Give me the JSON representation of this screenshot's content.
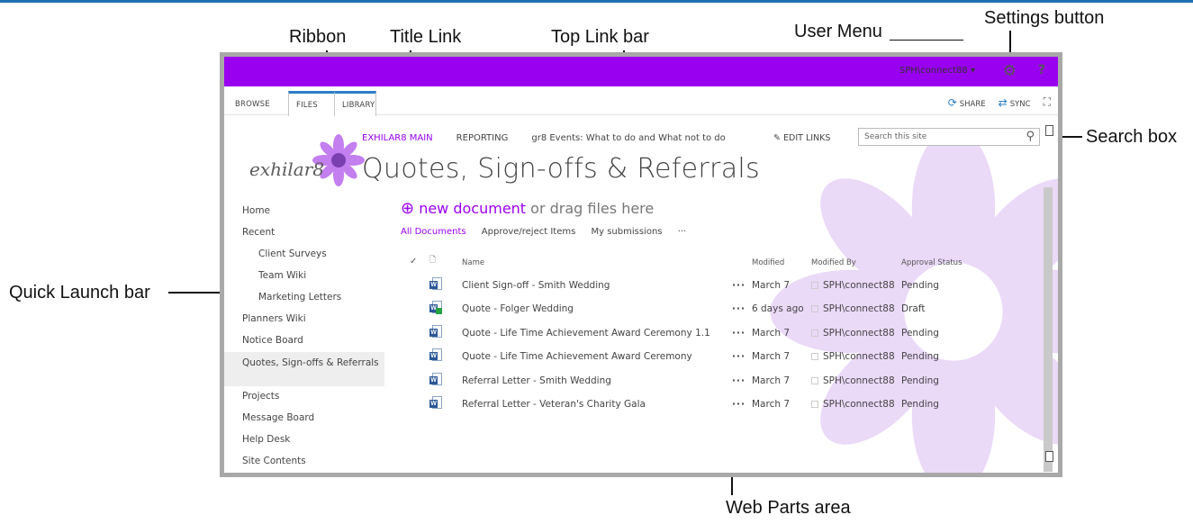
{
  "annotations": {
    "ribbon": "Ribbon",
    "title_link": "Title Link",
    "top_link_bar": "Top Link bar",
    "user_menu": "User Menu",
    "settings_button": "Settings button",
    "search_box": "Search box",
    "quick_launch_bar": "Quick Launch bar",
    "web_parts_area": "Web Parts area"
  },
  "suite_bar": {
    "user": "SPH\\connect88",
    "user_caret": "▾",
    "gear_icon": "gear-icon",
    "help": "?",
    "accent": "#9a00f0"
  },
  "ribbon": {
    "tabs": [
      "BROWSE",
      "FILES",
      "LIBRARY"
    ],
    "share": "SHARE",
    "sync": "SYNC"
  },
  "site": {
    "logo_text": "exhilar8",
    "top_links": [
      "EXHILAR8 MAIN",
      "REPORTING",
      "gr8 Events: What to do and What not to do"
    ],
    "edit_links": "EDIT LINKS",
    "search_placeholder": "Search this site",
    "page_title": "Quotes, Sign-offs & Referrals"
  },
  "quick_launch": [
    {
      "label": "Home",
      "sub": false
    },
    {
      "label": "Recent",
      "sub": false
    },
    {
      "label": "Client Surveys",
      "sub": true
    },
    {
      "label": "Team Wiki",
      "sub": true
    },
    {
      "label": "Marketing Letters",
      "sub": true
    },
    {
      "label": "Planners Wiki",
      "sub": false
    },
    {
      "label": "Notice Board",
      "sub": false
    },
    {
      "label": "Quotes, Sign-offs & Referrals",
      "sub": false,
      "selected": true
    },
    {
      "label": "Projects",
      "sub": false
    },
    {
      "label": "Message Board",
      "sub": false
    },
    {
      "label": "Help Desk",
      "sub": false
    },
    {
      "label": "Site Contents",
      "sub": false
    }
  ],
  "library": {
    "new_document": "new document",
    "drag_text": "or drag files here",
    "views": [
      "All Documents",
      "Approve/reject Items",
      "My submissions",
      "···"
    ],
    "columns": {
      "check": "✓",
      "name": "Name",
      "modified": "Modified",
      "modified_by": "Modified By",
      "approval_status": "Approval Status"
    },
    "rows": [
      {
        "name": "Client Sign-off - Smith Wedding",
        "modified": "March 7",
        "by": "SPH\\connect88",
        "status": "Pending",
        "new": false
      },
      {
        "name": "Quote - Folger Wedding",
        "modified": "6 days ago",
        "by": "SPH\\connect88",
        "status": "Draft",
        "new": true
      },
      {
        "name": "Quote - Life Time Achievement Award Ceremony 1.1",
        "modified": "March 7",
        "by": "SPH\\connect88",
        "status": "Pending",
        "new": false
      },
      {
        "name": "Quote - Life Time Achievement Award Ceremony",
        "modified": "March 7",
        "by": "SPH\\connect88",
        "status": "Pending",
        "new": false
      },
      {
        "name": "Referral Letter - Smith Wedding",
        "modified": "March 7",
        "by": "SPH\\connect88",
        "status": "Pending",
        "new": false
      },
      {
        "name": "Referral Letter - Veteran's Charity Gala",
        "modified": "March 7",
        "by": "SPH\\connect88",
        "status": "Pending",
        "new": false
      }
    ]
  }
}
